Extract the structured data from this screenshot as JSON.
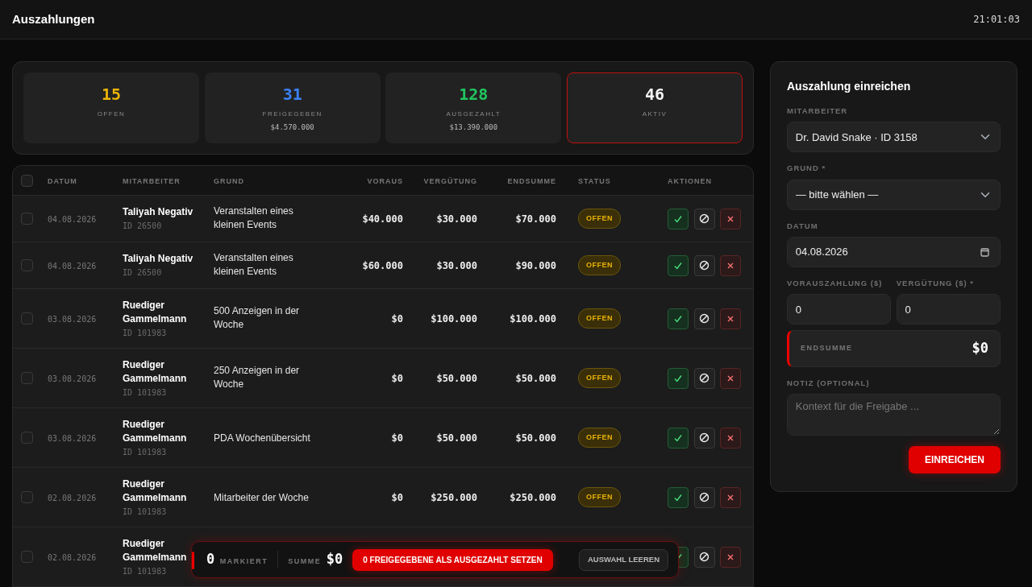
{
  "header": {
    "title": "Auszahlungen",
    "clock": "21:01:03"
  },
  "stats": [
    {
      "value": "15",
      "label": "OFFEN",
      "color": "#eab308",
      "selected": false
    },
    {
      "value": "31",
      "label": "FREIGEGEBEN",
      "sub": "$4.570.000",
      "color": "#3b82f6",
      "selected": false
    },
    {
      "value": "128",
      "label": "AUSGEZAHLT",
      "sub": "$13.390.000",
      "color": "#22c55e",
      "selected": false
    },
    {
      "value": "46",
      "label": "AKTIV",
      "color": "#f5f5f5",
      "selected": true
    }
  ],
  "table": {
    "header_checked": false,
    "columns": [
      "DATUM",
      "MITARBEITER",
      "GRUND",
      "VORAUS",
      "VERGÜTUNG",
      "ENDSUMME",
      "STATUS",
      "AKTIONEN"
    ],
    "rows": [
      {
        "checked": false,
        "date": "04.08.2026",
        "name": "Taliyah Negativ",
        "id": "ID 26500",
        "reason": "Veranstalten eines kleinen Events",
        "advance": "$40.000",
        "pay": "$30.000",
        "total": "$70.000",
        "status": {
          "text": "OFFEN",
          "kind": "open"
        }
      },
      {
        "checked": false,
        "date": "04.08.2026",
        "name": "Taliyah Negativ",
        "id": "ID 26500",
        "reason": "Veranstalten eines kleinen Events",
        "advance": "$60.000",
        "pay": "$30.000",
        "total": "$90.000",
        "status": {
          "text": "OFFEN",
          "kind": "open"
        }
      },
      {
        "checked": false,
        "date": "03.08.2026",
        "name": "Ruediger Gammelmann",
        "id": "ID 101983",
        "reason": "500 Anzeigen in der Woche",
        "advance": "$0",
        "pay": "$100.000",
        "total": "$100.000",
        "status": {
          "text": "OFFEN",
          "kind": "open"
        }
      },
      {
        "checked": false,
        "date": "03.08.2026",
        "name": "Ruediger Gammelmann",
        "id": "ID 101983",
        "reason": "250 Anzeigen in der Woche",
        "advance": "$0",
        "pay": "$50.000",
        "total": "$50.000",
        "status": {
          "text": "OFFEN",
          "kind": "open"
        }
      },
      {
        "checked": false,
        "date": "03.08.2026",
        "name": "Ruediger Gammelmann",
        "id": "ID 101983",
        "reason": "PDA Wochenübersicht",
        "advance": "$0",
        "pay": "$50.000",
        "total": "$50.000",
        "status": {
          "text": "OFFEN",
          "kind": "open"
        }
      },
      {
        "checked": false,
        "date": "02.08.2026",
        "name": "Ruediger Gammelmann",
        "id": "ID 101983",
        "reason": "Mitarbeiter der Woche",
        "advance": "$0",
        "pay": "$250.000",
        "total": "$250.000",
        "status": {
          "text": "OFFEN",
          "kind": "open"
        }
      },
      {
        "checked": false,
        "date": "02.08.2026",
        "name": "Ruediger Gammelmann",
        "id": "ID 101983"
      }
    ]
  },
  "selection_bar": {
    "count": "0",
    "count_label": "MARKIERT",
    "sum_label": "SUMME",
    "sum": "$0",
    "primary_button": "0 FREIGEGEBENE ALS AUSGEZAHLT SETZEN",
    "secondary_button": "AUSWAHL LEEREN"
  },
  "form": {
    "title": "Auszahlung einreichen",
    "employee_label": "MITARBEITER",
    "employee": "Dr. David Snake · ID 3158",
    "reason_label": "GRUND *",
    "reason": "— bitte wählen —",
    "date_label": "DATUM",
    "date": "04.08.2026",
    "advance_label": "VORAUSZAHLUNG ($)",
    "advance": "0",
    "pay_label": "VERGÜTUNG ($) *",
    "pay": "0",
    "total_label": "ENDSUMME",
    "total": "$0",
    "note_label": "NOTIZ (OPTIONAL)",
    "note_placeholder": "Kontext für die Freigabe ...",
    "submit": "EINREICHEN"
  }
}
